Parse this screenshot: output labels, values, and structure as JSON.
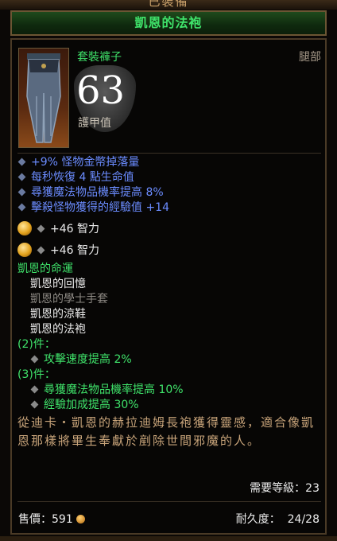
{
  "top_title": "已裝備",
  "item_name": "凱恩的法袍",
  "item_type": "套裝褲子",
  "slot": "腿部",
  "armor": {
    "value": "63",
    "label": "護甲值"
  },
  "magic_props": [
    "+9% 怪物金幣掉落量",
    "每秒恢復 4 點生命值",
    "尋獲魔法物品機率提高 8%",
    "擊殺怪物獲得的經驗值 +14"
  ],
  "sockets": [
    "+46 智力",
    "+46 智力"
  ],
  "set": {
    "name": "凱恩的命運",
    "pieces": [
      {
        "name": "凱恩的回憶",
        "owned": true
      },
      {
        "name": "凱恩的學士手套",
        "owned": false
      },
      {
        "name": "凱恩的涼鞋",
        "owned": true
      },
      {
        "name": "凱恩的法袍",
        "owned": true
      }
    ],
    "bonus2_label": "(2)件：",
    "bonus2": [
      "攻擊速度提高 2%"
    ],
    "bonus3_label": "(3)件：",
    "bonus3": [
      "尋獲魔法物品機率提高 10%",
      "經驗加成提高 30%"
    ]
  },
  "flavor_text": "從迪卡・凱恩的赫拉迪姆長袍獲得靈感，適合像凱恩那樣將畢生奉獻於剷除世間邪魔的人。",
  "required_level": "需要等級：23",
  "sell_value": "售價：591",
  "durability": {
    "label": "耐久度：",
    "value": "24/28"
  },
  "colors": {
    "set_green": "#3fe26a",
    "magic_blue": "#6b8cff",
    "flavor": "#c8a47a"
  }
}
